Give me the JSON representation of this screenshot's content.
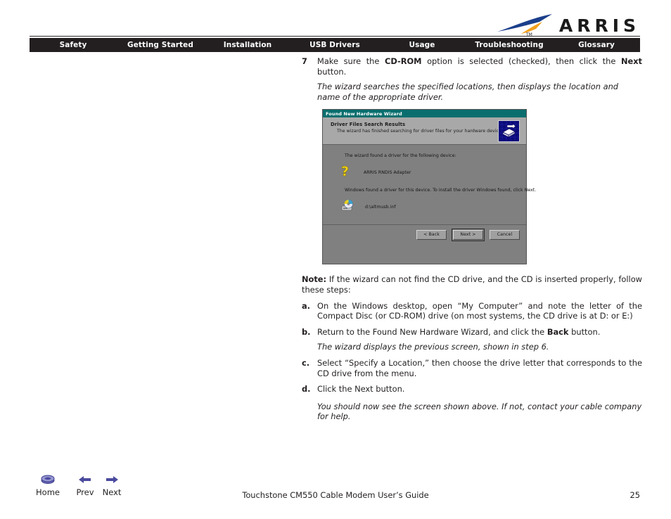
{
  "brand": {
    "name": "ARRIS",
    "logo_icon": "arris-swoosh-logo",
    "swoosh_blue": "#1b3f8b",
    "swoosh_orange": "#f2a01e",
    "wordmark_color": "#1a1a1a"
  },
  "nav": {
    "background": "#231f20",
    "items": [
      {
        "label": "Safety"
      },
      {
        "label": "Getting Started"
      },
      {
        "label": "Installation"
      },
      {
        "label": "USB Drivers"
      },
      {
        "label": "Usage"
      },
      {
        "label": "Troubleshooting"
      },
      {
        "label": "Glossary"
      }
    ]
  },
  "content": {
    "step7": {
      "number": "7",
      "text_1": "Make sure the ",
      "bold_1": "CD-ROM",
      "text_2": " option is selected (checked), then click the ",
      "bold_2": "Next",
      "text_3": " button.",
      "note_italic": "The wizard searches the specified locations, then displays the location and name of the appropriate driver."
    },
    "note": {
      "label": "Note:",
      "text": " If the wizard can not find the CD drive, and the CD is inserted properly, follow these steps:"
    },
    "substeps": [
      {
        "letter": "a.",
        "text": "On the Windows desktop, open “My Computer” and note the letter of the Compact Disc (or CD-ROM) drive (on most systems, the CD drive is at D: or E:)"
      },
      {
        "letter": "b.",
        "text_1": "Return to the Found New Hardware Wizard, and click the ",
        "bold_1": "Back",
        "text_2": " button.",
        "italic": "The wizard displays the previous screen, shown in step 6."
      },
      {
        "letter": "c.",
        "text": "Select “Specify a Location,” then choose the drive letter that corresponds to the CD drive from the menu."
      },
      {
        "letter": "d.",
        "text": "Click the Next button.",
        "italic": "You should now see the screen shown above. If not, contact your cable company for help."
      }
    ]
  },
  "wizard": {
    "titlebar": "Found New Hardware Wizard",
    "titlebar_color": "#0a6e6e",
    "header_title": "Driver Files Search Results",
    "header_subtitle": "The wizard has finished searching for driver files for your hardware device.",
    "header_icon": "driver-search-wizard-icon",
    "body_line_1": "The wizard found a driver for the following device:",
    "device_icon": "unknown-device-question-icon",
    "device_name": "ARRIS RNDIS Adapter",
    "body_line_2": "Windows found a driver for this device. To install the driver Windows found, click Next.",
    "driver_icon": "cd-drive-icon",
    "driver_path": "d:\\altmusb.inf",
    "buttons": [
      {
        "label": "< Back",
        "default": false
      },
      {
        "label": "Next >",
        "default": true
      },
      {
        "label": "Cancel",
        "default": false
      }
    ]
  },
  "footer": {
    "nav": [
      {
        "label": "Home",
        "icon": "home-disc-icon"
      },
      {
        "label": "Prev",
        "icon": "left-arrow-icon"
      },
      {
        "label": "Next",
        "icon": "right-arrow-icon"
      }
    ],
    "nav_icon_color": "#4a4a9e",
    "title": "Touchstone CM550 Cable Modem User’s Guide",
    "page_number": "25"
  }
}
